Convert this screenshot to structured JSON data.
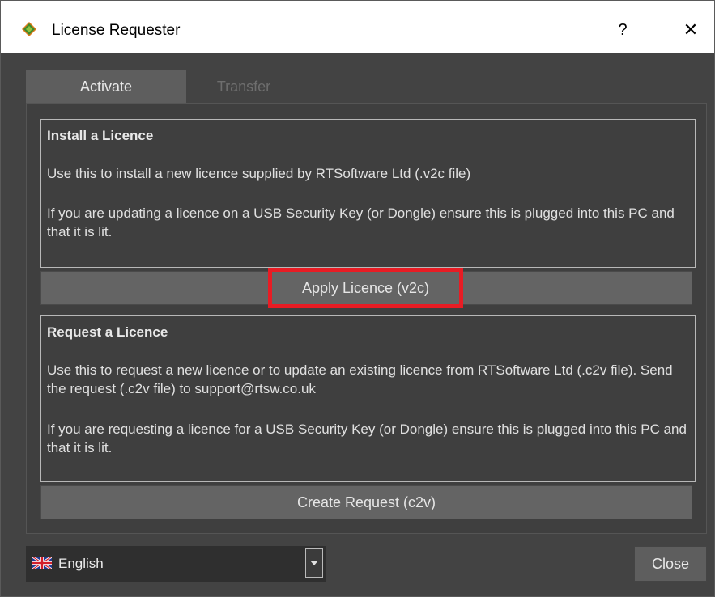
{
  "window": {
    "title": "License Requester"
  },
  "titlebar": {
    "help": "?",
    "close": "✕"
  },
  "tabs": [
    {
      "label": "Activate",
      "active": true
    },
    {
      "label": "Transfer",
      "active": false
    }
  ],
  "install": {
    "title": "Install a Licence",
    "line1": "Use this to install a new licence supplied by RTSoftware Ltd (.v2c file)",
    "line2": "If you are updating a licence on a USB Security Key (or Dongle) ensure this is plugged into this PC and that it is lit.",
    "button": "Apply Licence (v2c)"
  },
  "request": {
    "title": "Request a Licence",
    "line1": "Use this to request a new licence or to update an existing licence from RTSoftware Ltd (.c2v file). Send the request (.c2v file) to support@rtsw.co.uk",
    "line2": "If you are requesting a licence for a USB Security Key (or Dongle) ensure this is plugged into this PC and that it is lit.",
    "button": "Create Request (c2v)"
  },
  "footer": {
    "language": "English",
    "close": "Close"
  },
  "colors": {
    "highlight": "#e81c24",
    "panel_bg": "#434343",
    "accent_green": "#4a8a2a"
  }
}
